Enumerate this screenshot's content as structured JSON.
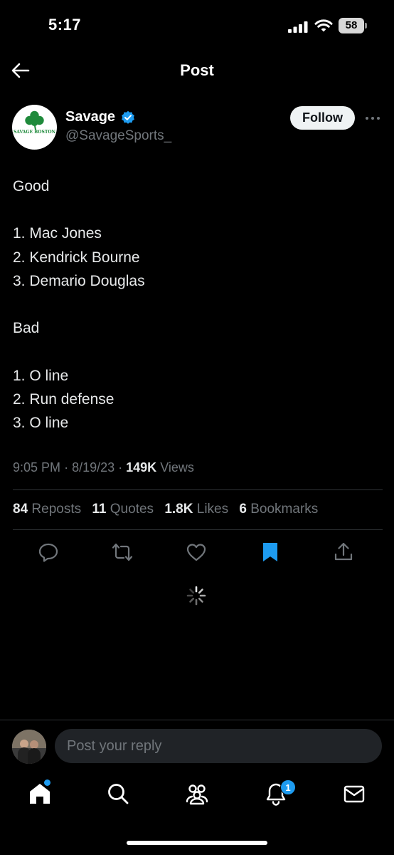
{
  "status_bar": {
    "time": "5:17",
    "battery": "58"
  },
  "nav": {
    "title": "Post"
  },
  "author": {
    "name": "Savage",
    "handle": "@SavageSports_",
    "avatar_text": "SAVAGE BOSTON"
  },
  "follow_label": "Follow",
  "post": {
    "lines": [
      "Good",
      "",
      "1. Mac Jones",
      "2. Kendrick Bourne",
      "3. Demario Douglas",
      "",
      "Bad",
      "",
      "1. O line",
      "2. Run defense",
      "3. O line"
    ],
    "time": "9:05 PM",
    "date": "8/19/23",
    "views_count": "149K",
    "views_label": "Views"
  },
  "stats": [
    {
      "count": "84",
      "label": "Reposts"
    },
    {
      "count": "11",
      "label": "Quotes"
    },
    {
      "count": "1.8K",
      "label": "Likes"
    },
    {
      "count": "6",
      "label": "Bookmarks"
    }
  ],
  "reply": {
    "placeholder": "Post your reply"
  },
  "notifications_badge": "1",
  "colors": {
    "accent": "#1d9bf0",
    "background": "#000000",
    "muted_text": "#71767b",
    "logo_green": "#1f8a3b"
  }
}
